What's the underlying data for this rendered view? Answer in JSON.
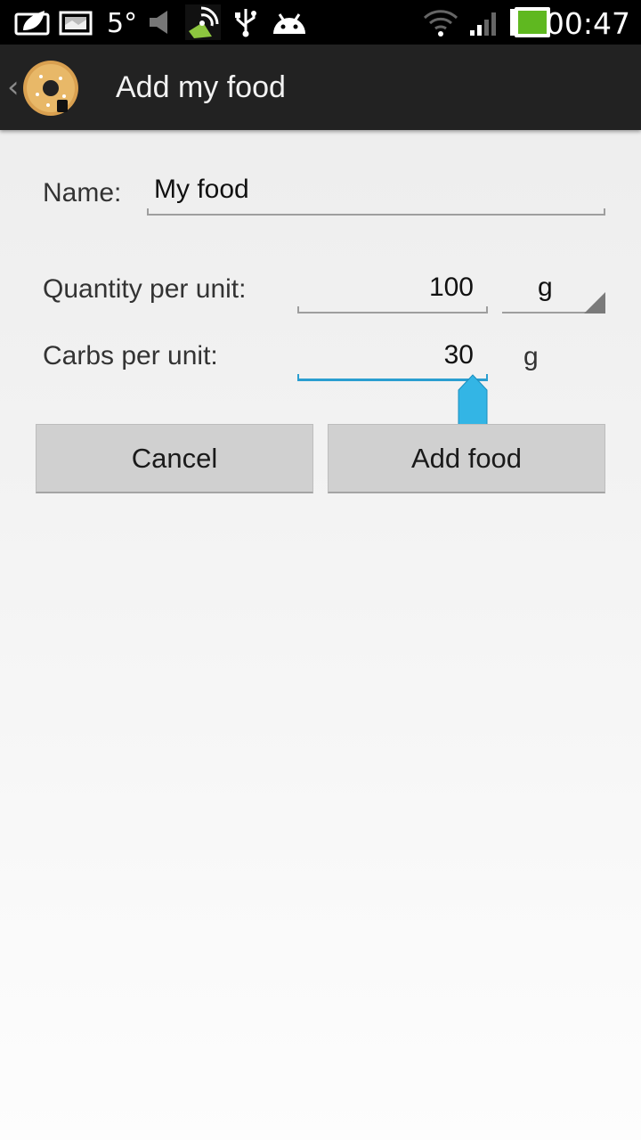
{
  "status_bar": {
    "temperature": "5°",
    "time": "00:47",
    "icons": [
      "leaf-battery-saver-icon",
      "gallery-icon",
      "media-mute-icon",
      "app-notification-icon",
      "usb-icon",
      "android-debug-icon",
      "wifi-icon",
      "signal-icon",
      "battery-icon"
    ],
    "battery_color": "#5fb820"
  },
  "action_bar": {
    "title": "Add my food",
    "logo_icon": "donut-logo-icon",
    "up_icon": "chevron-left-icon"
  },
  "form": {
    "name_label": "Name:",
    "name_value": "My food",
    "quantity_label": "Quantity per unit:",
    "quantity_value": "100",
    "quantity_unit": "g",
    "carbs_label": "Carbs per unit:",
    "carbs_value": "30",
    "carbs_unit": "g"
  },
  "buttons": {
    "cancel": "Cancel",
    "add": "Add food"
  },
  "colors": {
    "accent": "#33b5e5",
    "action_bar": "#222222",
    "button": "#d0d0d0"
  }
}
